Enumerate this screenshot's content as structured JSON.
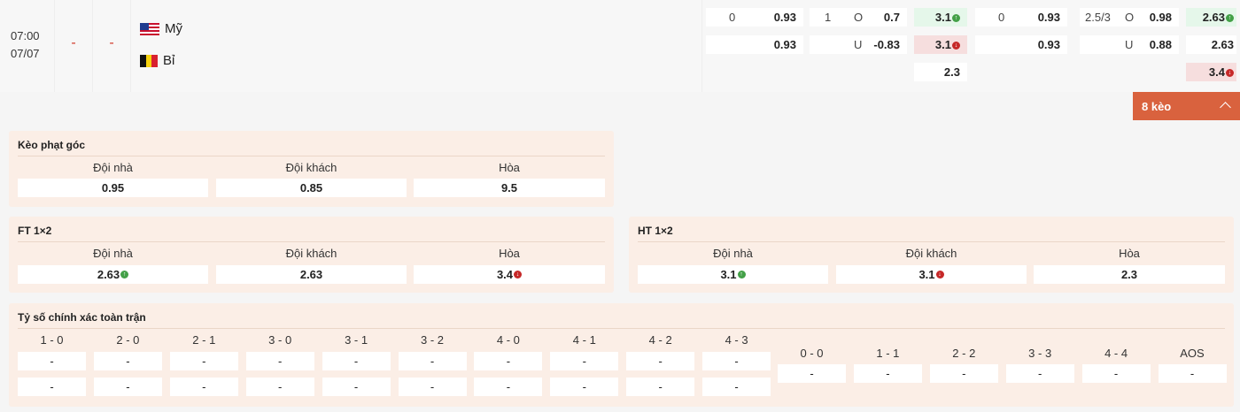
{
  "match": {
    "time": "07:00",
    "date": "07/07",
    "score_home": "-",
    "score_away": "-",
    "home_team": "Mỹ",
    "away_team": "Bỉ"
  },
  "odds": {
    "ah_ft_home_line": "0",
    "ah_ft_home": "0.93",
    "ah_ft_away": "0.93",
    "ou_ft_line": "1",
    "ou_ft_over_label": "O",
    "ou_ft_over": "0.7",
    "ou_ft_under_label": "U",
    "ou_ft_under": "-0.83",
    "x12_ft_home": "3.1",
    "x12_ft_away": "3.1",
    "x12_ft_draw": "2.3",
    "ah_ht_home_line": "0",
    "ah_ht_home": "0.93",
    "ah_ht_away": "0.93",
    "ou_ht_line": "2.5/3",
    "ou_ht_over_label": "O",
    "ou_ht_over": "0.98",
    "ou_ht_under_label": "U",
    "ou_ht_under": "0.88",
    "x12_ht_home": "2.63",
    "x12_ht_away": "2.63",
    "x12_ht_draw": "3.4"
  },
  "more_button": {
    "label": "8 kèo"
  },
  "corner": {
    "title": "Kèo phạt góc",
    "headers": [
      "Đội nhà",
      "Đội khách",
      "Hòa"
    ],
    "values": [
      "0.95",
      "0.85",
      "9.5"
    ]
  },
  "ft": {
    "title": "FT 1×2",
    "headers": [
      "Đội nhà",
      "Đội khách",
      "Hòa"
    ],
    "values": [
      "2.63",
      "2.63",
      "3.4"
    ]
  },
  "ht": {
    "title": "HT 1×2",
    "headers": [
      "Đội nhà",
      "Đội khách",
      "Hòa"
    ],
    "values": [
      "3.1",
      "3.1",
      "2.3"
    ]
  },
  "correct_score": {
    "title": "Tỷ số chính xác toàn trận",
    "left_headers": [
      "1 - 0",
      "2 - 0",
      "2 - 1",
      "3 - 0",
      "3 - 1",
      "3 - 2",
      "4 - 0",
      "4 - 1",
      "4 - 2",
      "4 - 3"
    ],
    "right_headers": [
      "0 - 0",
      "1 - 1",
      "2 - 2",
      "3 - 3",
      "4 - 4",
      "AOS"
    ],
    "empty": "-"
  }
}
